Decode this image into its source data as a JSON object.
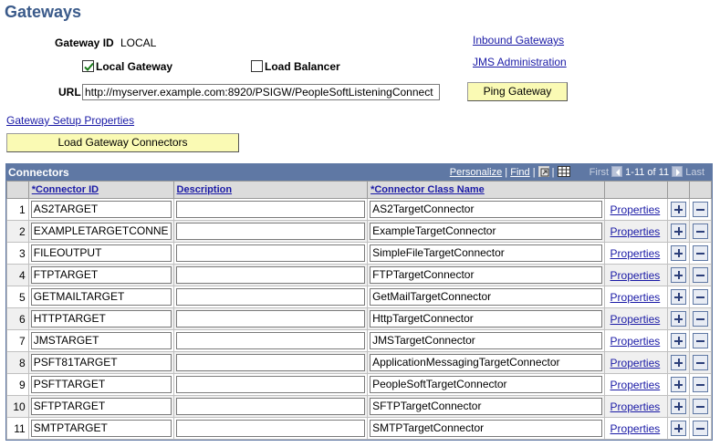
{
  "page": {
    "title": "Gateways"
  },
  "gateway": {
    "id_label": "Gateway ID",
    "id_value": "LOCAL",
    "local_gateway_label": "Local Gateway",
    "local_gateway_checked": true,
    "load_balancer_label": "Load Balancer",
    "load_balancer_checked": false,
    "url_label": "URL",
    "url_value": "http://myserver.example.com:8920/PSIGW/PeopleSoftListeningConnect",
    "ping_button": "Ping Gateway",
    "setup_link": "Gateway Setup Properties",
    "load_connectors_button": "Load Gateway Connectors"
  },
  "links": {
    "inbound": "Inbound Gateways",
    "jms": "JMS Administration"
  },
  "grid": {
    "title": "Connectors",
    "personalize": "Personalize",
    "find": "Find",
    "first": "First",
    "range": "1-11 of 11",
    "last": "Last",
    "columns": {
      "connector_id": "*Connector ID",
      "description": "Description",
      "class_name": "*Connector Class Name"
    },
    "properties_label": "Properties",
    "rows": [
      {
        "num": "1",
        "id": "AS2TARGET",
        "description": "",
        "class": "AS2TargetConnector"
      },
      {
        "num": "2",
        "id": "EXAMPLETARGETCONNE",
        "description": "",
        "class": "ExampleTargetConnector"
      },
      {
        "num": "3",
        "id": "FILEOUTPUT",
        "description": "",
        "class": "SimpleFileTargetConnector"
      },
      {
        "num": "4",
        "id": "FTPTARGET",
        "description": "",
        "class": "FTPTargetConnector"
      },
      {
        "num": "5",
        "id": "GETMAILTARGET",
        "description": "",
        "class": "GetMailTargetConnector"
      },
      {
        "num": "6",
        "id": "HTTPTARGET",
        "description": "",
        "class": "HttpTargetConnector"
      },
      {
        "num": "7",
        "id": "JMSTARGET",
        "description": "",
        "class": "JMSTargetConnector"
      },
      {
        "num": "8",
        "id": "PSFT81TARGET",
        "description": "",
        "class": "ApplicationMessagingTargetConnector"
      },
      {
        "num": "9",
        "id": "PSFTTARGET",
        "description": "",
        "class": "PeopleSoftTargetConnector"
      },
      {
        "num": "10",
        "id": "SFTPTARGET",
        "description": "",
        "class": "SFTPTargetConnector"
      },
      {
        "num": "11",
        "id": "SMTPTARGET",
        "description": "",
        "class": "SMTPTargetConnector"
      }
    ]
  },
  "colors": {
    "title": "#3a5a8a",
    "grid_header": "#5f78a4",
    "button_yellow": "#fafab4",
    "link": "#1a1aa6"
  }
}
